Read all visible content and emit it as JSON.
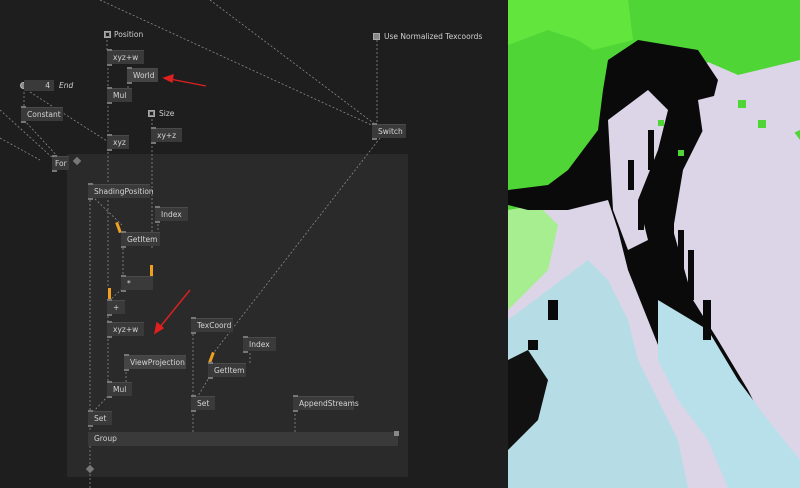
{
  "patch": {
    "iobox_position": {
      "label": "Position"
    },
    "iobox_size": {
      "label": "Size"
    },
    "iobox_texcoords": {
      "label": "Use Normalized Texcoords"
    },
    "iobox_count": {
      "value": "4",
      "label": "End"
    },
    "nodes": {
      "xyzw_top": "xyz+w",
      "world": "World",
      "mul_top": "Mul",
      "xy_z": "xy+z",
      "constant": "Constant",
      "switch": "Switch",
      "xyz": "xyz",
      "for": "For",
      "shading_position": "ShadingPosition",
      "index_top": "Index",
      "getitem_top": "GetItem",
      "multiply": "*",
      "plus": "+",
      "xyzw_bottom": "xyz+w",
      "texcoord": "TexCoord",
      "index_bottom": "Index",
      "viewprojection": "ViewProjection",
      "getitem_bottom": "GetItem",
      "mul_bottom": "Mul",
      "set_texcoord": "Set",
      "appendstreams": "AppendStreams",
      "set_position": "Set",
      "group": "Group"
    }
  },
  "colors": {
    "background": "#1e1e1e",
    "region": "#2a2a2a",
    "node": "#3a3a3a",
    "pin_accent": "#f0a020",
    "annotation_arrow": "#e02020",
    "preview_green": "#4fd636",
    "preview_lavender": "#dcd5e8",
    "preview_lightblue": "#b6dde6"
  }
}
